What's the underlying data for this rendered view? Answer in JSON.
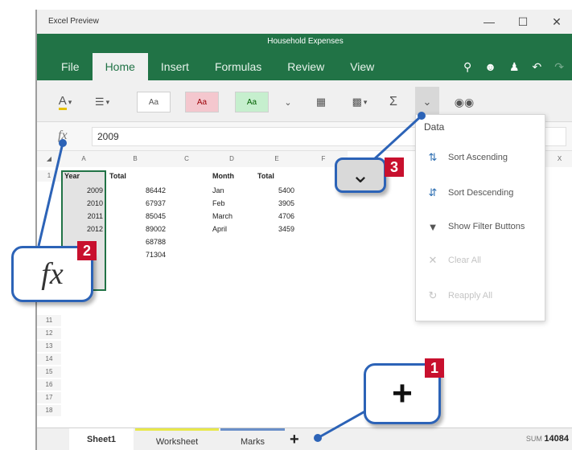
{
  "window": {
    "app_name": "Excel Preview",
    "controls": {
      "minimize": "—",
      "maximize": "☐",
      "close": "✕"
    }
  },
  "ribbon": {
    "document_title": "Household Expenses",
    "tabs": [
      {
        "label": "File",
        "active": false
      },
      {
        "label": "Home",
        "active": true
      },
      {
        "label": "Insert",
        "active": false
      },
      {
        "label": "Formulas",
        "active": false
      },
      {
        "label": "Review",
        "active": false
      },
      {
        "label": "View",
        "active": false
      }
    ],
    "right_icons": [
      "lightbulb-icon",
      "smiley-icon",
      "share-icon",
      "undo-icon",
      "redo-icon"
    ],
    "accent_color": "#217346"
  },
  "toolbar": {
    "font_color_label": "A",
    "style_1": "Aa",
    "style_2": "Aa",
    "style_3": "Aa",
    "sum_label": "Σ",
    "data_chevron": "⌄"
  },
  "formula_bar": {
    "fx_label": "fx",
    "value": "2009"
  },
  "grid": {
    "columns": [
      "A",
      "B",
      "C",
      "D",
      "E",
      "F",
      "X"
    ],
    "rows": [
      "1",
      "2",
      "3",
      "4",
      "5",
      "6",
      "7",
      "8",
      "9",
      "10",
      "11",
      "12",
      "13",
      "14",
      "15",
      "16",
      "17",
      "18"
    ],
    "table1": {
      "headers": [
        "Year",
        "Total"
      ],
      "rows": [
        [
          "2009",
          "86442"
        ],
        [
          "2010",
          "67937"
        ],
        [
          "2011",
          "85045"
        ],
        [
          "2012",
          "89002"
        ],
        [
          "",
          "68788"
        ],
        [
          "",
          "71304"
        ]
      ]
    },
    "table2": {
      "headers": [
        "Month",
        "Total"
      ],
      "rows": [
        [
          "Jan",
          "5400"
        ],
        [
          "Feb",
          "3905"
        ],
        [
          "March",
          "4706"
        ],
        [
          "April",
          "3459"
        ]
      ]
    }
  },
  "data_menu": {
    "title": "Data",
    "items": [
      {
        "label": "Sort Ascending",
        "icon": "sort-ascending-icon",
        "glyph": "⇅",
        "enabled": true
      },
      {
        "label": "Sort Descending",
        "icon": "sort-descending-icon",
        "glyph": "⇵",
        "enabled": true
      },
      {
        "label": "Show Filter Buttons",
        "icon": "filter-icon",
        "glyph": "▼",
        "enabled": true
      },
      {
        "label": "Clear All",
        "icon": "clear-filter-icon",
        "glyph": "✕",
        "enabled": false
      },
      {
        "label": "Reapply All",
        "icon": "reapply-filter-icon",
        "glyph": "↻",
        "enabled": false
      }
    ]
  },
  "sheets": {
    "tabs": [
      {
        "label": "Sheet1",
        "color": ""
      },
      {
        "label": "Worksheet",
        "color": "#e8e84a"
      },
      {
        "label": "Marks",
        "color": "#6a8fc9"
      }
    ],
    "add_label": "+",
    "sum_label": "SUM",
    "sum_value": "14084"
  },
  "callouts": {
    "one": {
      "badge": "1",
      "glyph": "+"
    },
    "two": {
      "badge": "2",
      "glyph": "fx"
    },
    "three": {
      "badge": "3",
      "glyph": "⌄"
    },
    "badge_color": "#c8102e",
    "border_color": "#2c63b7"
  }
}
